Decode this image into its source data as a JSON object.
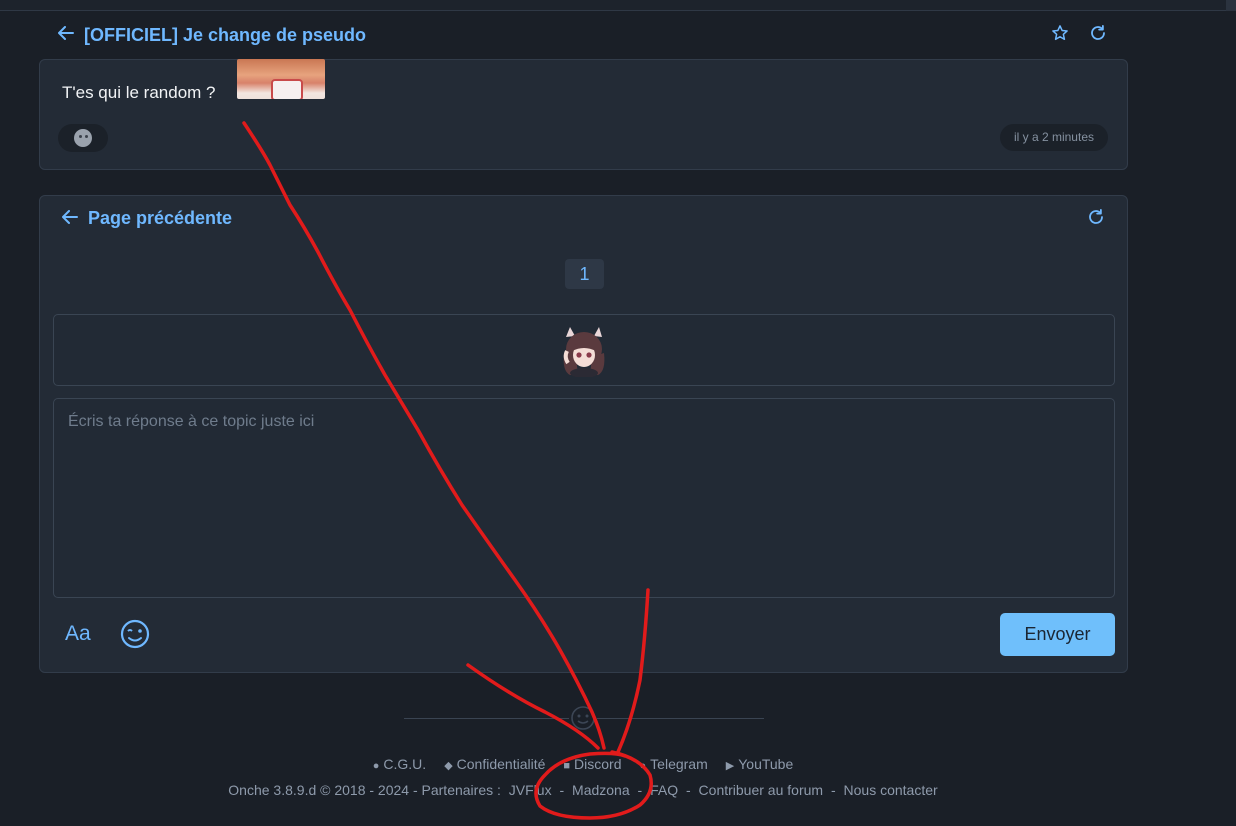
{
  "topic": {
    "title": "[OFFICIEL] Je change de pseudo",
    "back_icon": "arrow-left-icon",
    "favorite_icon": "star-icon",
    "refresh_icon": "refresh-icon"
  },
  "message": {
    "text": "T'es qui le random ?",
    "time": "il y a 2 minutes"
  },
  "reply": {
    "prev_label": "Page précédente",
    "page": "1",
    "placeholder": "Écris ta réponse à ce topic juste ici",
    "format_label": "Aa",
    "send_label": "Envoyer"
  },
  "footer": {
    "links": [
      {
        "icon": "info-icon",
        "label": "C.G.U."
      },
      {
        "icon": "shield-icon",
        "label": "Confidentialité"
      },
      {
        "icon": "discord-icon",
        "label": "Discord"
      },
      {
        "icon": "chat-bubble-icon",
        "label": "Telegram"
      },
      {
        "icon": "youtube-icon",
        "label": "YouTube"
      }
    ],
    "version": "Onche 3.8.9.d © 2018 - 2024 - Partenaires :",
    "partner1": "JVFlux",
    "partner2": "Madzona",
    "faq": "FAQ",
    "contribute": "Contribuer au forum",
    "contact": "Nous contacter"
  },
  "colors": {
    "accent": "#6fb8ff",
    "background": "#1a1f27",
    "card": "#232b36",
    "annotation": "#e11b1b"
  }
}
